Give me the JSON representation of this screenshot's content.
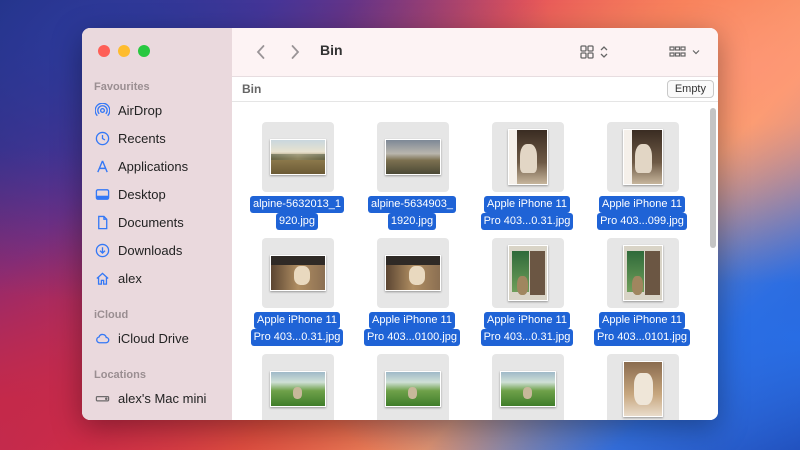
{
  "window": {
    "title": "Bin"
  },
  "sidebar": {
    "sections": [
      {
        "label": "Favourites",
        "items": [
          {
            "label": "AirDrop",
            "icon": "airdrop-icon"
          },
          {
            "label": "Recents",
            "icon": "clock-icon"
          },
          {
            "label": "Applications",
            "icon": "applications-icon"
          },
          {
            "label": "Desktop",
            "icon": "desktop-icon"
          },
          {
            "label": "Documents",
            "icon": "document-icon"
          },
          {
            "label": "Downloads",
            "icon": "download-icon"
          },
          {
            "label": "alex",
            "icon": "home-icon"
          }
        ]
      },
      {
        "label": "iCloud",
        "items": [
          {
            "label": "iCloud Drive",
            "icon": "cloud-icon"
          }
        ]
      },
      {
        "label": "Locations",
        "items": [
          {
            "label": "alex's Mac mini",
            "icon": "drive-icon"
          }
        ]
      }
    ]
  },
  "toolbar": {
    "back_icon": "chevron-left-icon",
    "forward_icon": "chevron-right-icon",
    "view_icon": "icon-grid-view-icon",
    "group_icon": "group-by-icon",
    "more_icon": "double-chevron-right-icon",
    "search_icon": "search-icon"
  },
  "pathbar": {
    "label": "Bin",
    "empty_button": "Empty"
  },
  "colors": {
    "selection": "#1f63d6",
    "accent": "#3478f6"
  },
  "files": [
    {
      "line1": "alpine-5632013_1",
      "line2": "920.jpg",
      "kind": "landscape-valley"
    },
    {
      "line1": "alpine-5634903_",
      "line2": "1920.jpg",
      "kind": "landscape-field"
    },
    {
      "line1": "Apple iPhone 11",
      "line2": "Pro 403...0.31.jpg",
      "kind": "portrait-llama"
    },
    {
      "line1": "Apple iPhone 11",
      "line2": "Pro 403...099.jpg",
      "kind": "portrait-llama"
    },
    {
      "line1": "Apple iPhone 11",
      "line2": "Pro 403...0.31.jpg",
      "kind": "landscape-dog"
    },
    {
      "line1": "Apple iPhone 11",
      "line2": "Pro 403...0100.jpg",
      "kind": "landscape-dog"
    },
    {
      "line1": "Apple iPhone 11",
      "line2": "Pro 403...0.31.jpg",
      "kind": "portrait-door"
    },
    {
      "line1": "Apple iPhone 11",
      "line2": "Pro 403...0101.jpg",
      "kind": "portrait-door"
    },
    {
      "line1": "",
      "line2": "",
      "kind": "landscape-grass"
    },
    {
      "line1": "",
      "line2": "",
      "kind": "landscape-grass"
    },
    {
      "line1": "",
      "line2": "",
      "kind": "landscape-grass"
    },
    {
      "line1": "",
      "line2": "",
      "kind": "portrait-cat"
    }
  ]
}
